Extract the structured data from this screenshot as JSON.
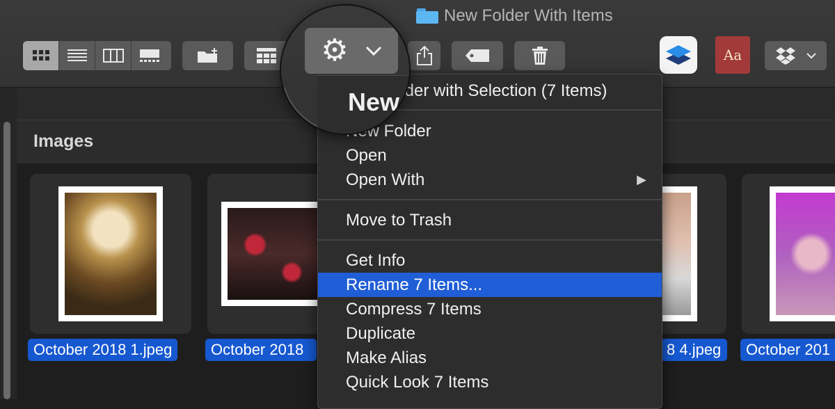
{
  "window": {
    "title": "New Folder With Items"
  },
  "toolbar": {
    "view_modes": [
      {
        "name": "icon-view",
        "icon": "icon-grid-icon",
        "active": true
      },
      {
        "name": "list-view",
        "icon": "list-icon",
        "active": false
      },
      {
        "name": "column-view",
        "icon": "columns-icon",
        "active": false
      },
      {
        "name": "gallery-view",
        "icon": "gallery-icon",
        "active": false
      }
    ],
    "buttons": [
      "new-folder-icon",
      "group-by-icon",
      "action-gear-icon",
      "share-icon",
      "tag-icon",
      "trash-icon"
    ],
    "apps": [
      "layers-app-icon",
      "dictionary-app-icon",
      "dropbox-icon"
    ],
    "dictionary_label": "Aa"
  },
  "section": {
    "title": "Images"
  },
  "files": [
    {
      "label": "October 2018 1.jpeg"
    },
    {
      "label": "October 2018"
    },
    {
      "label": "8 4.jpeg"
    },
    {
      "label": "October 201"
    }
  ],
  "context_menu": {
    "items": [
      {
        "label": "New Folder with Selection (7 Items)",
        "visible_label": "older with Selection (7 Items)"
      },
      {
        "label": "New Folder"
      },
      {
        "label": "Open"
      },
      {
        "label": "Open With",
        "submenu": true
      },
      {
        "label": "Move to Trash"
      },
      {
        "label": "Get Info"
      },
      {
        "label": "Rename 7 Items...",
        "highlighted": true
      },
      {
        "label": "Compress 7 Items"
      },
      {
        "label": "Duplicate"
      },
      {
        "label": "Make Alias"
      },
      {
        "label": "Quick Look 7 Items"
      }
    ]
  },
  "magnifier": {
    "text": "New"
  },
  "colors": {
    "accent": "#1f5ed6",
    "selection": "#1658d0",
    "folder": "#5cb6f2"
  }
}
